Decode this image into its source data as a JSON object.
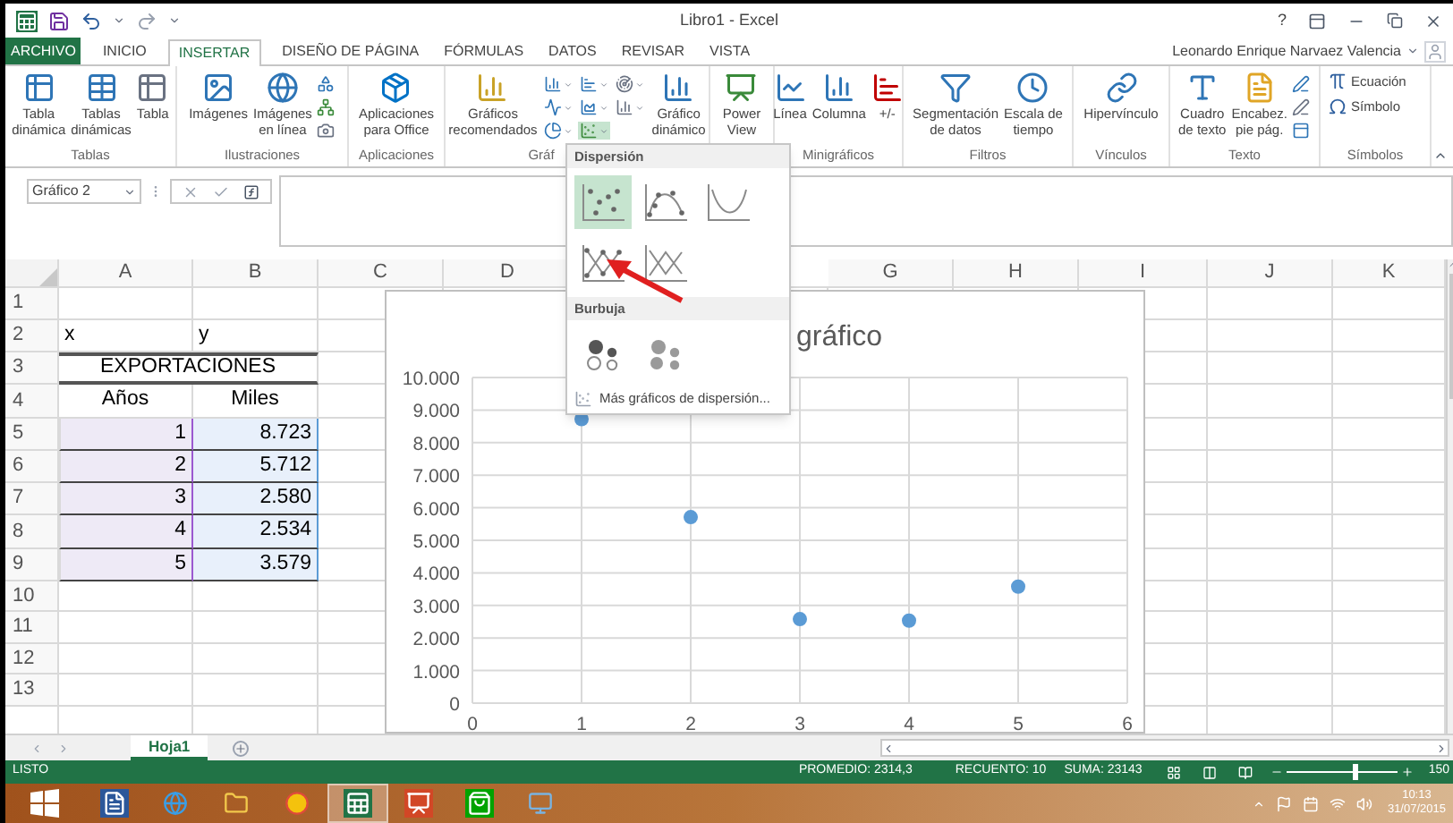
{
  "title_bar": {
    "title": "Libro1 - Excel",
    "help": "?"
  },
  "tabs": [
    {
      "label": "ARCHIVO",
      "kind": "file",
      "selected": false
    },
    {
      "label": "INICIO",
      "kind": "tab",
      "selected": false
    },
    {
      "label": "INSERTAR",
      "kind": "tab",
      "selected": true
    },
    {
      "label": "DISEÑO DE PÁGINA",
      "kind": "tab",
      "selected": false
    },
    {
      "label": "FÓRMULAS",
      "kind": "tab",
      "selected": false
    },
    {
      "label": "DATOS",
      "kind": "tab",
      "selected": false
    },
    {
      "label": "REVISAR",
      "kind": "tab",
      "selected": false
    },
    {
      "label": "VISTA",
      "kind": "tab",
      "selected": false
    }
  ],
  "account": {
    "name": "Leonardo Enrique Narvaez Valencia"
  },
  "ribbon": {
    "groups": [
      {
        "label": "Tablas",
        "kind": "large",
        "buttons": [
          "Tabla\ndinámica",
          "Tablas\ndinámicas",
          "Tabla"
        ]
      },
      {
        "label": "Ilustraciones",
        "kind": "large",
        "buttons": [
          "Imágenes",
          "Imágenes\nen línea"
        ]
      },
      {
        "label": "Aplicaciones",
        "kind": "large",
        "buttons": [
          "Aplicaciones\npara Office"
        ]
      },
      {
        "label": "Gráf",
        "kind": "large",
        "buttons": [
          "Gráficos\nrecomendados",
          "Gráfico\ndinámico"
        ]
      },
      {
        "kind": "large",
        "buttons": [
          "Power\nView"
        ]
      },
      {
        "label": "Minigráficos",
        "kind": "large",
        "buttons": [
          "Línea",
          "Columna",
          "+/-"
        ]
      },
      {
        "label": "Filtros",
        "kind": "large",
        "buttons": [
          "Segmentación\nde datos",
          "Escala de\ntiempo"
        ]
      },
      {
        "label": "Vínculos",
        "kind": "large",
        "buttons": [
          "Hipervínculo"
        ]
      },
      {
        "label": "Texto",
        "kind": "large",
        "buttons": [
          "Cuadro\nde texto",
          "Encabez.\npie pág."
        ]
      },
      {
        "label": "Símbolos",
        "kind": "small",
        "buttons": [
          "Ecuación",
          "Símbolo"
        ]
      }
    ]
  },
  "formula_bar": {
    "name_box": "Gráfico 2"
  },
  "columns": [
    "A",
    "B",
    "C",
    "D",
    "G",
    "H",
    "I",
    "J",
    "K"
  ],
  "rows": [
    {
      "header": "1",
      "kind": "blank",
      "selected": false
    },
    {
      "header": "2",
      "kind": "plain",
      "cells": [
        "x",
        "y"
      ],
      "selected": false
    },
    {
      "header": "3",
      "kind": "title",
      "cells": [
        "EXPORTACIONES"
      ],
      "selected": false
    },
    {
      "header": "4",
      "kind": "heading",
      "cells": [
        "Años",
        "Miles"
      ],
      "selected": false
    },
    {
      "header": "5",
      "kind": "number",
      "cells": [
        "1",
        "8.723"
      ],
      "selected": true
    },
    {
      "header": "6",
      "kind": "number",
      "cells": [
        "2",
        "5.712"
      ],
      "selected": true
    },
    {
      "header": "7",
      "kind": "number",
      "cells": [
        "3",
        "2.580"
      ],
      "selected": true
    },
    {
      "header": "8",
      "kind": "number",
      "cells": [
        "4",
        "2.534"
      ],
      "selected": true
    },
    {
      "header": "9",
      "kind": "number",
      "cells": [
        "5",
        "3.579"
      ],
      "selected": true
    },
    {
      "header": "10",
      "kind": "blank",
      "selected": false
    },
    {
      "header": "11",
      "kind": "blank",
      "selected": false
    },
    {
      "header": "12",
      "kind": "blank",
      "selected": false
    },
    {
      "header": "13",
      "kind": "blank",
      "selected": false
    }
  ],
  "chart": {
    "chart_data": {
      "type": "scatter",
      "title": "gráfico",
      "x": [
        1,
        2,
        3,
        4,
        5
      ],
      "series": [
        {
          "color": "#5b9bd5",
          "values": [
            8723,
            5712,
            2580,
            2534,
            3579
          ]
        }
      ],
      "grid": true,
      "xlim": [
        0,
        6
      ],
      "ylim": [
        0,
        10000
      ],
      "xticks": [
        0,
        1,
        2,
        3,
        4,
        5,
        6
      ],
      "yticks": [
        {
          "value": 0,
          "label": "0"
        },
        {
          "value": 1000,
          "label": "1.000"
        },
        {
          "value": 2000,
          "label": "2.000"
        },
        {
          "value": 3000,
          "label": "3.000"
        },
        {
          "value": 4000,
          "label": "4.000"
        },
        {
          "value": 5000,
          "label": "5.000"
        },
        {
          "value": 6000,
          "label": "6.000"
        },
        {
          "value": 7000,
          "label": "7.000"
        },
        {
          "value": 8000,
          "label": "8.000"
        },
        {
          "value": 9000,
          "label": "9.000"
        },
        {
          "value": 10000,
          "label": "10.000"
        }
      ]
    }
  },
  "chart_menu": {
    "sections": [
      {
        "label": "Dispersión",
        "options": [
          {
            "kind": "markers",
            "selected": true
          },
          {
            "kind": "smooth-markers",
            "selected": false
          },
          {
            "kind": "smooth",
            "selected": false
          },
          {
            "kind": "lines-markers",
            "selected": false
          },
          {
            "kind": "lines",
            "selected": false
          }
        ]
      },
      {
        "label": "Burbuja",
        "options": [
          {
            "kind": "bubble",
            "selected": false
          },
          {
            "kind": "bubble-3d",
            "selected": false
          }
        ]
      }
    ],
    "more": "Más gráficos de dispersión..."
  },
  "sheet_tabs": [
    {
      "label": "Hoja1",
      "selected": true
    }
  ],
  "status_bar": {
    "mode": "LISTO",
    "average": "PROMEDIO: 2314,3",
    "count": "RECUENTO: 10",
    "sum": "SUMA: 23143",
    "zoom": {
      "level": 0.62
    },
    "zoom_text": "150"
  },
  "taskbar": {
    "apps": [
      {
        "kind": "word",
        "selected": false
      },
      {
        "kind": "browser",
        "selected": false
      },
      {
        "kind": "files",
        "selected": false
      },
      {
        "kind": "chrome",
        "selected": false
      },
      {
        "kind": "excel",
        "selected": true
      },
      {
        "kind": "slides",
        "selected": false
      },
      {
        "kind": "store",
        "selected": false
      },
      {
        "kind": "photos",
        "selected": false
      }
    ],
    "time": "10:13",
    "date": "31/07/2015"
  }
}
